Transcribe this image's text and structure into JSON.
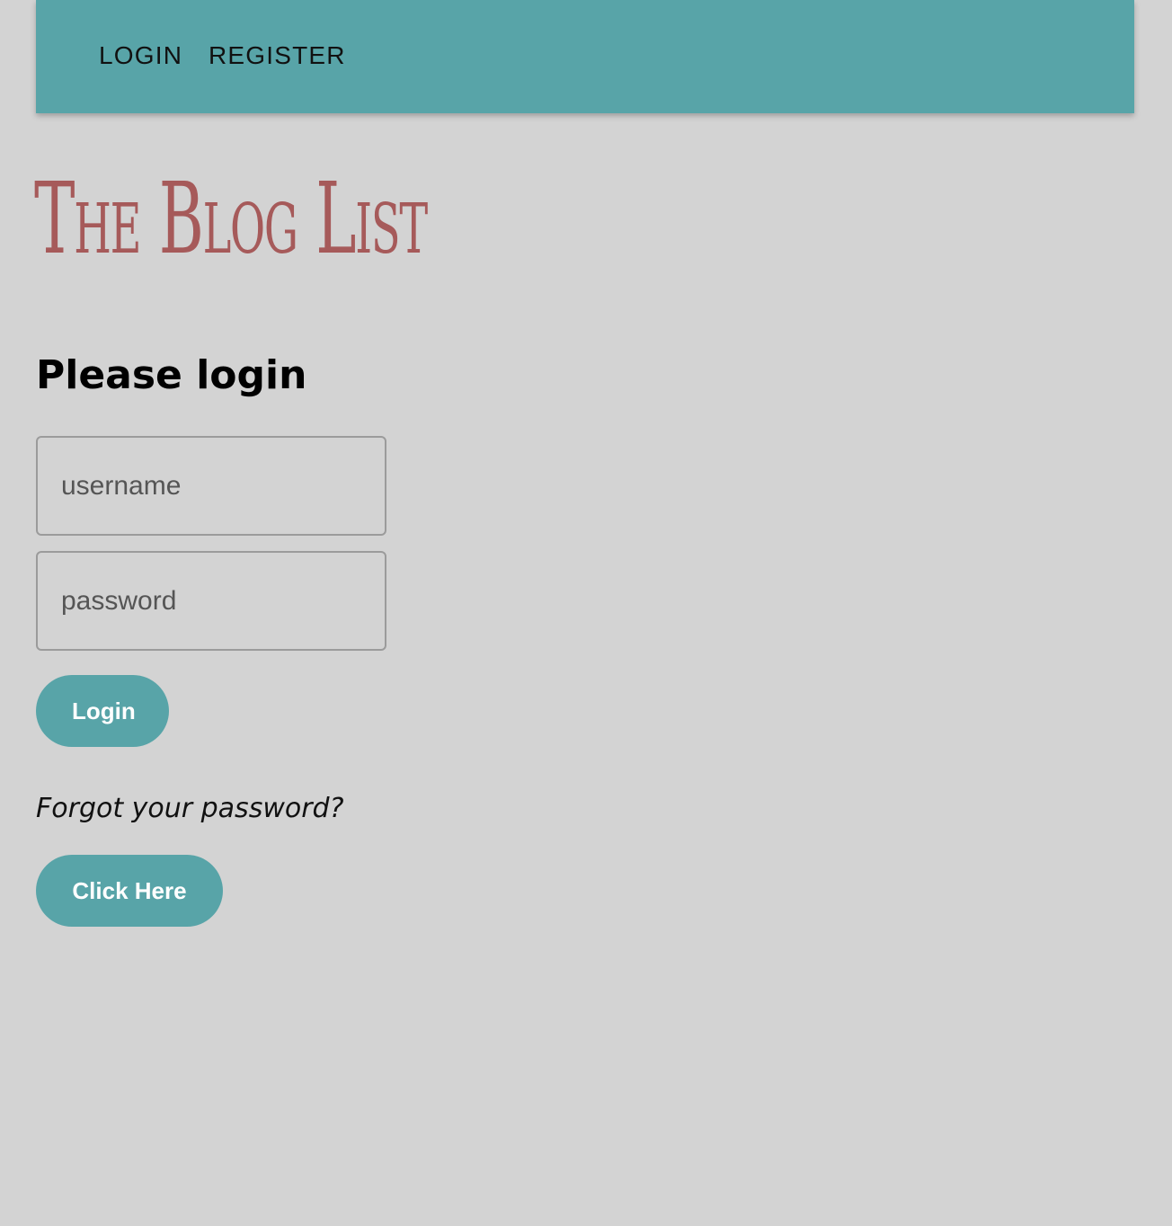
{
  "nav": {
    "login_label": "LOGIN",
    "register_label": "REGISTER"
  },
  "site": {
    "title": "The Blog List"
  },
  "login_form": {
    "heading": "Please login",
    "username_placeholder": "username",
    "password_placeholder": "password",
    "submit_label": "Login"
  },
  "forgot": {
    "prompt": "Forgot your password?",
    "button_label": "Click Here"
  },
  "colors": {
    "page_background": "#d3d3d3",
    "accent": "#58a4a8",
    "title": "#a65a5a"
  }
}
